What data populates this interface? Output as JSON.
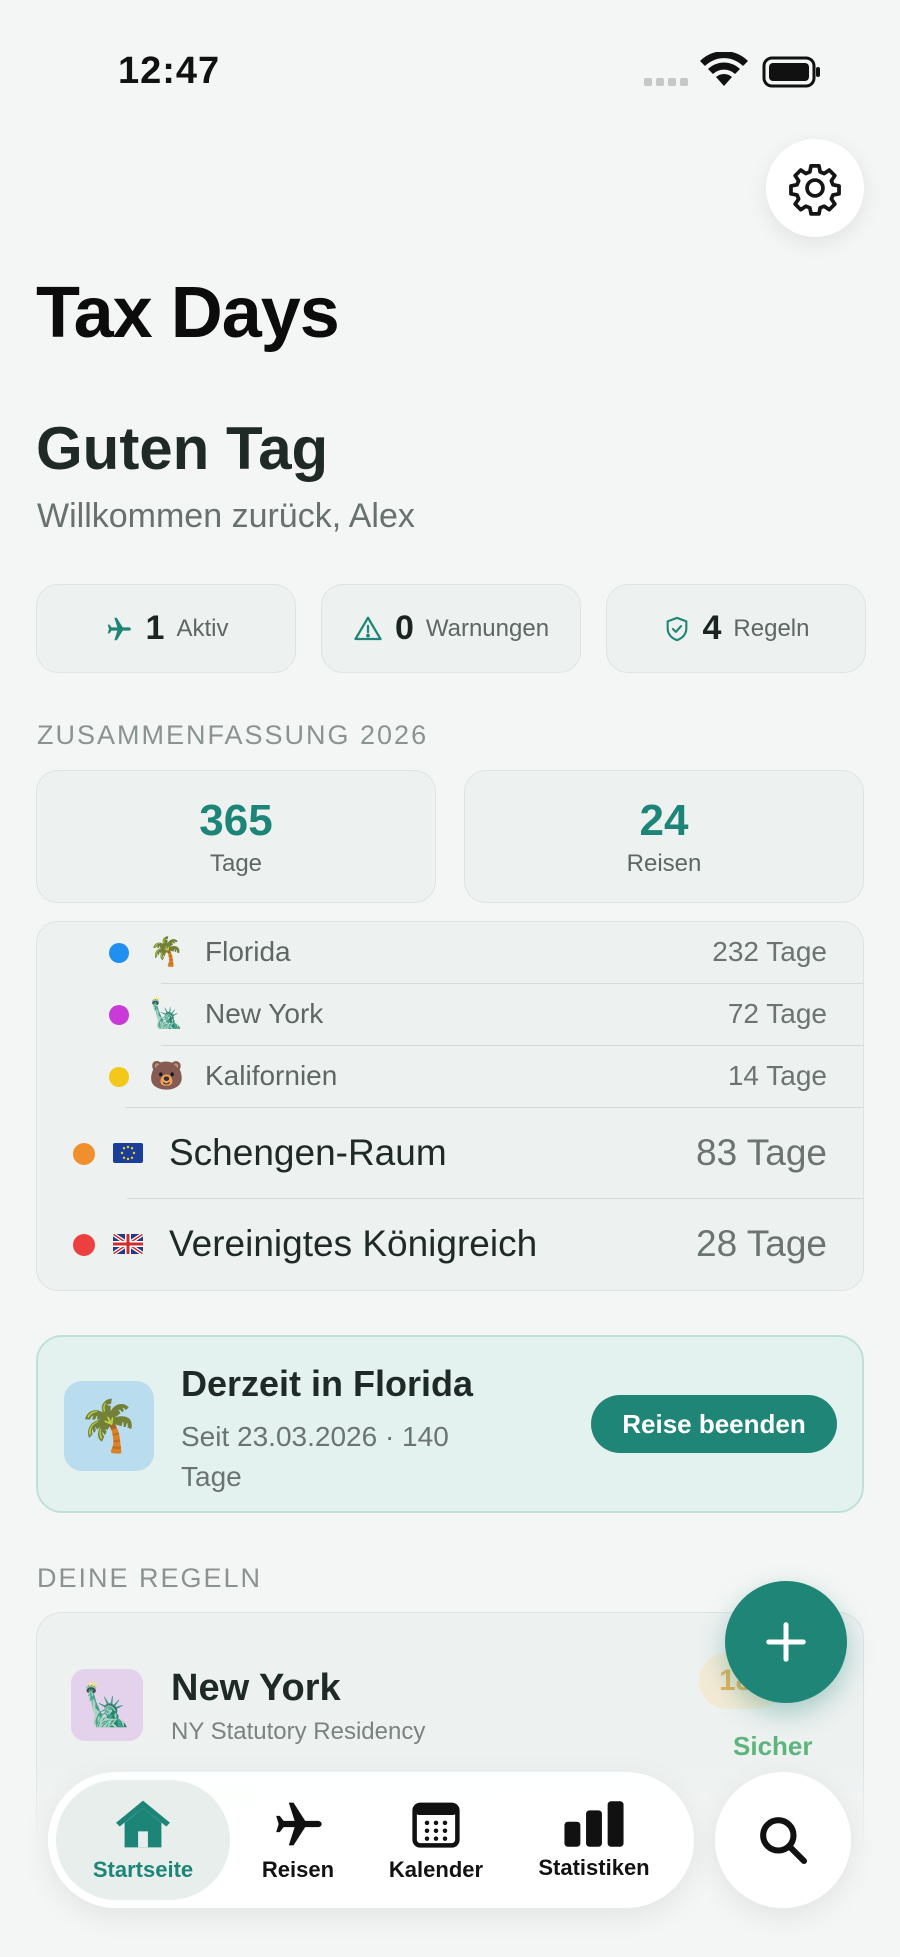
{
  "status_bar": {
    "time": "12:47"
  },
  "app": {
    "title": "Tax Days",
    "greeting": "Guten Tag",
    "welcome": "Willkommen zurück, Alex"
  },
  "pills": [
    {
      "count": "1",
      "label": "Aktiv",
      "icon": "airplane-icon"
    },
    {
      "count": "0",
      "label": "Warnungen",
      "icon": "warning-icon"
    },
    {
      "count": "4",
      "label": "Regeln",
      "icon": "shield-check-icon"
    }
  ],
  "summary": {
    "section_label": "ZUSAMMENFASSUNG 2026",
    "days_value": "365",
    "days_label": "Tage",
    "trips_value": "24",
    "trips_label": "Reisen"
  },
  "regions": [
    {
      "name": "Florida",
      "days": "232 Tage",
      "emoji": "🌴",
      "color": "#1f8ff0"
    },
    {
      "name": "New York",
      "days": "72 Tage",
      "emoji": "🗽",
      "color": "#c93ad6"
    },
    {
      "name": "Kalifornien",
      "days": "14 Tage",
      "emoji": "🐻",
      "color": "#f4c81b"
    },
    {
      "name": "Schengen-Raum",
      "days": "83 Tage",
      "emoji": "eu-flag-icon",
      "color": "#f08f2e"
    },
    {
      "name": "Vereinigtes Königreich",
      "days": "28 Tage",
      "emoji": "uk-flag-icon",
      "color": "#ec3f3f"
    }
  ],
  "current_trip": {
    "emoji": "🌴",
    "title": "Derzeit in Florida",
    "subtitle": "Seit 23.03.2026 · 140 Tage",
    "end_button": "Reise beenden"
  },
  "rules": {
    "section_label": "DEINE REGELN",
    "items": [
      {
        "emoji": "🗽",
        "name": "New York",
        "description": "NY Statutory Residency",
        "badge": "18",
        "status": "Sicher"
      }
    ]
  },
  "tab_bar": {
    "tabs": [
      {
        "label": "Startseite",
        "icon": "home-icon",
        "active": true
      },
      {
        "label": "Reisen",
        "icon": "airplane-icon",
        "active": false
      },
      {
        "label": "Kalender",
        "icon": "calendar-icon",
        "active": false
      },
      {
        "label": "Statistiken",
        "icon": "bar-chart-icon",
        "active": false
      }
    ]
  },
  "colors": {
    "accent": "#1f8576",
    "background": "#f4f6f5",
    "safe": "#5db47c"
  }
}
